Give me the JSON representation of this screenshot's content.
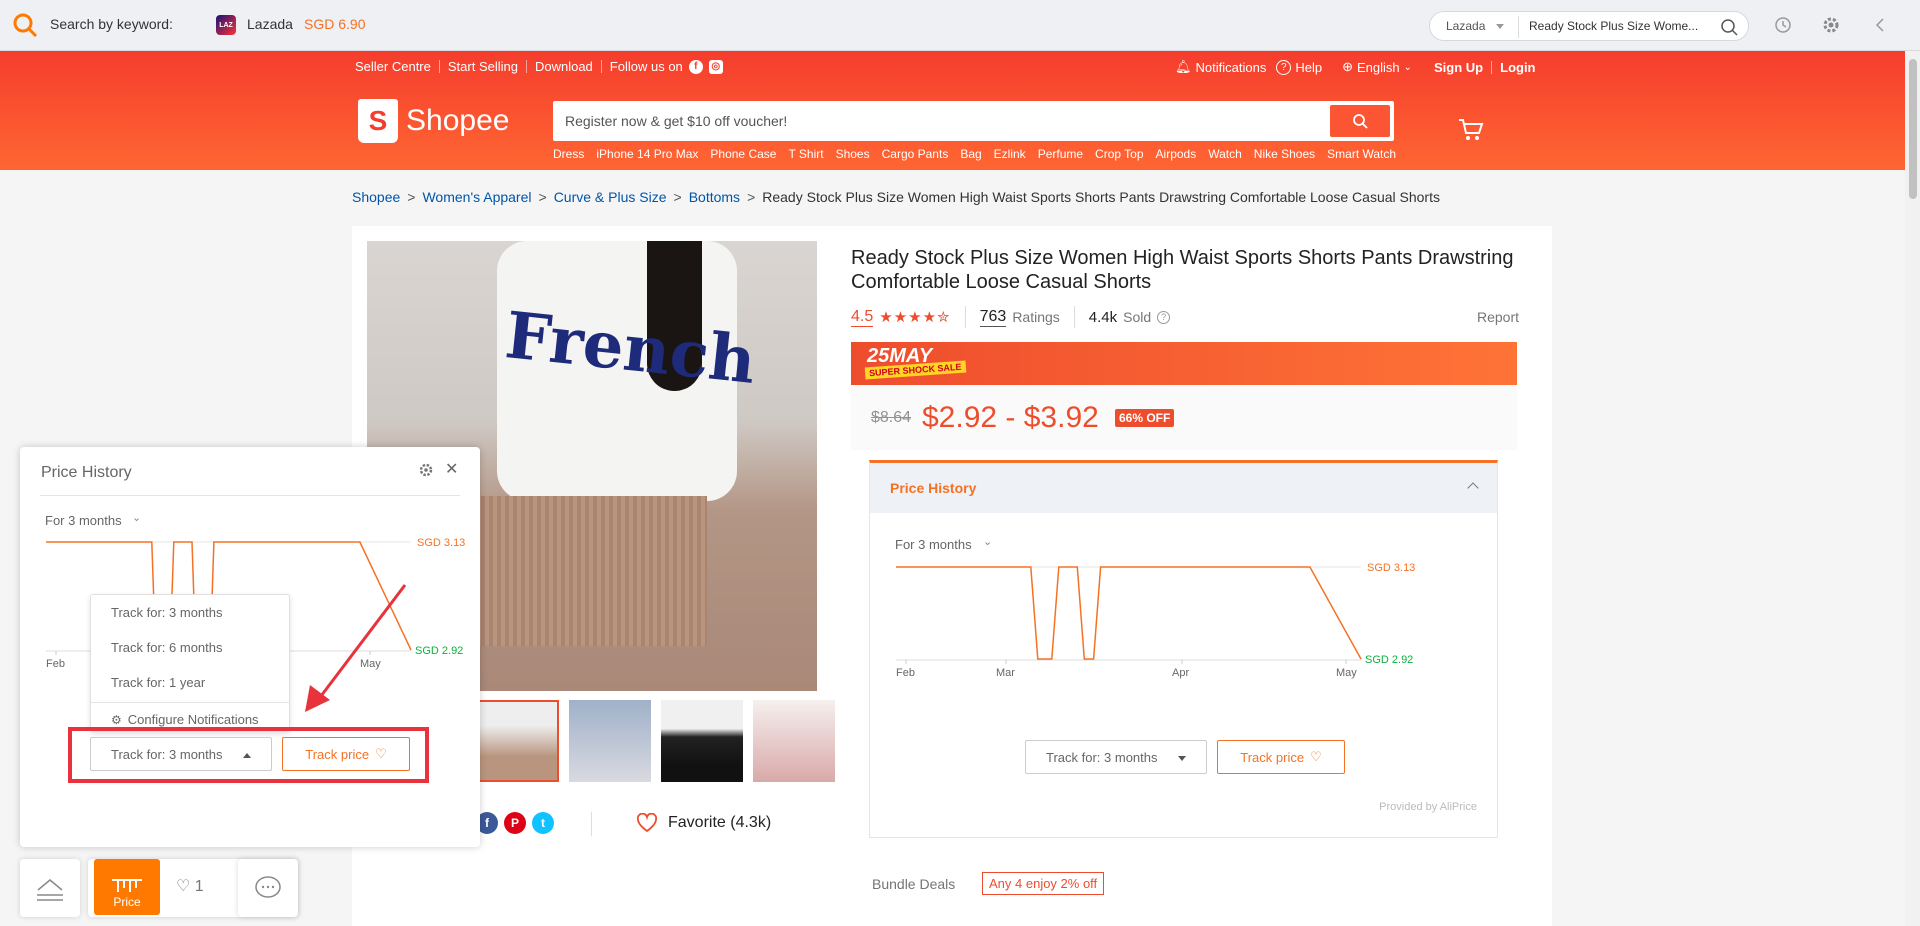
{
  "topbar": {
    "search_label": "Search by keyword:",
    "store_badge": "LAZ",
    "store_name": "Lazada",
    "store_price": "SGD 6.90",
    "store_select": "Lazada",
    "query": "Ready Stock Plus Size Wome..."
  },
  "header": {
    "links": [
      "Seller Centre",
      "Start Selling",
      "Download"
    ],
    "follow": "Follow us on",
    "notifications": "Notifications",
    "help": "Help",
    "language": "English",
    "signup": "Sign Up",
    "login": "Login",
    "logo": "Shopee",
    "search_placeholder": "Register now & get $10 off voucher!",
    "keywords": [
      "Dress",
      "iPhone 14 Pro Max",
      "Phone Case",
      "T Shirt",
      "Shoes",
      "Cargo Pants",
      "Bag",
      "Ezlink",
      "Perfume",
      "Crop Top",
      "Airpods",
      "Watch",
      "Nike Shoes",
      "Smart Watch"
    ]
  },
  "breadcrumb": {
    "items": [
      "Shopee",
      "Women's Apparel",
      "Curve & Plus Size",
      "Bottoms"
    ],
    "current": "Ready Stock Plus Size Women High Waist Sports Shorts Pants Drawstring Comfortable Loose Casual Shorts"
  },
  "product": {
    "title": "Ready Stock Plus Size Women High Waist Sports Shorts Pants Drawstring Comfortable Loose Casual Shorts",
    "rating": "4.5",
    "rating_value": 4.5,
    "ratings_count": "763",
    "ratings_label": "Ratings",
    "sold": "4.4k",
    "sold_label": "Sold",
    "report": "Report",
    "banner_title": "25MAY",
    "banner_sub": "SUPER SHOCK SALE",
    "old_price": "$8.64",
    "price": "$2.92 - $3.92",
    "discount": "66% OFF",
    "image_text": "French",
    "favorite": "Favorite (4.3k)",
    "bundle_label": "Bundle Deals",
    "bundle_deal": "Any 4 enjoy 2% off"
  },
  "price_history": {
    "title": "Price History",
    "period": "For 3 months",
    "track_select": "Track for: 3 months",
    "track_button": "Track price",
    "provided": "Provided by AliPrice"
  },
  "popup": {
    "title": "Price History",
    "period": "For 3 months",
    "options": [
      "Track for: 3 months",
      "Track for: 6 months",
      "Track for: 1 year"
    ],
    "configure": "Configure Notifications",
    "track_select": "Track for: 3 months",
    "track_button": "Track price"
  },
  "chart_data": [
    {
      "type": "line",
      "title": "Price History",
      "x_ticks": [
        "Feb",
        "Mar",
        "Apr",
        "May"
      ],
      "series": [
        {
          "values": [
            3.13,
            3.13,
            3.13,
            2.92,
            2.92,
            3.13,
            3.13,
            2.92,
            2.92,
            3.13,
            3.13,
            3.13,
            2.92
          ]
        }
      ],
      "x_positions": [
        0,
        0.29,
        0.29,
        0.305,
        0.335,
        0.35,
        0.39,
        0.405,
        0.425,
        0.44,
        0.89,
        0.89,
        1.0
      ],
      "max_label": "SGD 3.13",
      "min_label": "SGD 2.92",
      "ylim": [
        2.92,
        3.13
      ]
    },
    {
      "type": "line",
      "title": "Price History",
      "x_ticks": [
        "Feb",
        "May"
      ],
      "series": [
        {
          "values": [
            3.13,
            3.13,
            2.92,
            2.92,
            3.13,
            3.13,
            2.92,
            2.92,
            3.13,
            3.13,
            2.92
          ]
        }
      ],
      "x_positions": [
        0,
        0.29,
        0.3,
        0.34,
        0.35,
        0.4,
        0.41,
        0.45,
        0.46,
        0.86,
        1.0
      ],
      "max_label": "SGD 3.13",
      "min_label": "SGD 2.92",
      "ylim": [
        2.92,
        3.13
      ]
    }
  ],
  "dock": {
    "price": "Price",
    "fav_count": "1"
  },
  "colors": {
    "brand": "#ee4d2d",
    "accent": "#f57224",
    "low": "#0bb13e"
  }
}
